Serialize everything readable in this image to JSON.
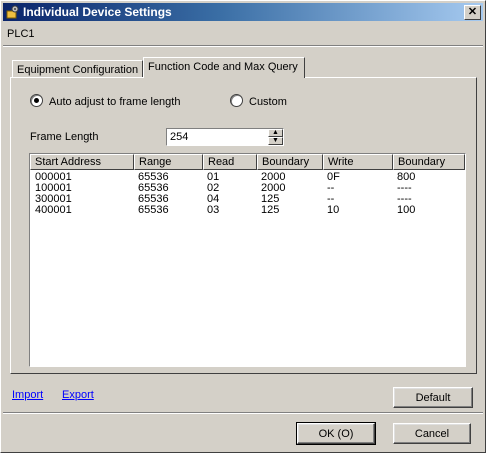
{
  "window": {
    "title": "Individual Device Settings",
    "close_glyph": "✕"
  },
  "device": {
    "name": "PLC1"
  },
  "tabs": [
    {
      "label": "Equipment Configuration"
    },
    {
      "label": "Function Code and Max Query"
    }
  ],
  "frame_mode": {
    "auto_label": "Auto adjust to frame length",
    "custom_label": "Custom",
    "selected": "auto"
  },
  "frame_length": {
    "label": "Frame Length",
    "value": "254"
  },
  "table": {
    "columns": [
      "Start Address",
      "Range",
      "Read",
      "Boundary",
      "Write",
      "Boundary"
    ],
    "rows": [
      [
        "000001",
        "65536",
        "01",
        "2000",
        "0F",
        "800"
      ],
      [
        "100001",
        "65536",
        "02",
        "2000",
        "--",
        "----"
      ],
      [
        "300001",
        "65536",
        "04",
        "125",
        "--",
        "----"
      ],
      [
        "400001",
        "65536",
        "03",
        "125",
        "10",
        "100"
      ]
    ]
  },
  "links": {
    "import": "Import",
    "export": "Export"
  },
  "buttons": {
    "default": "Default",
    "ok": "OK (O)",
    "cancel": "Cancel"
  }
}
